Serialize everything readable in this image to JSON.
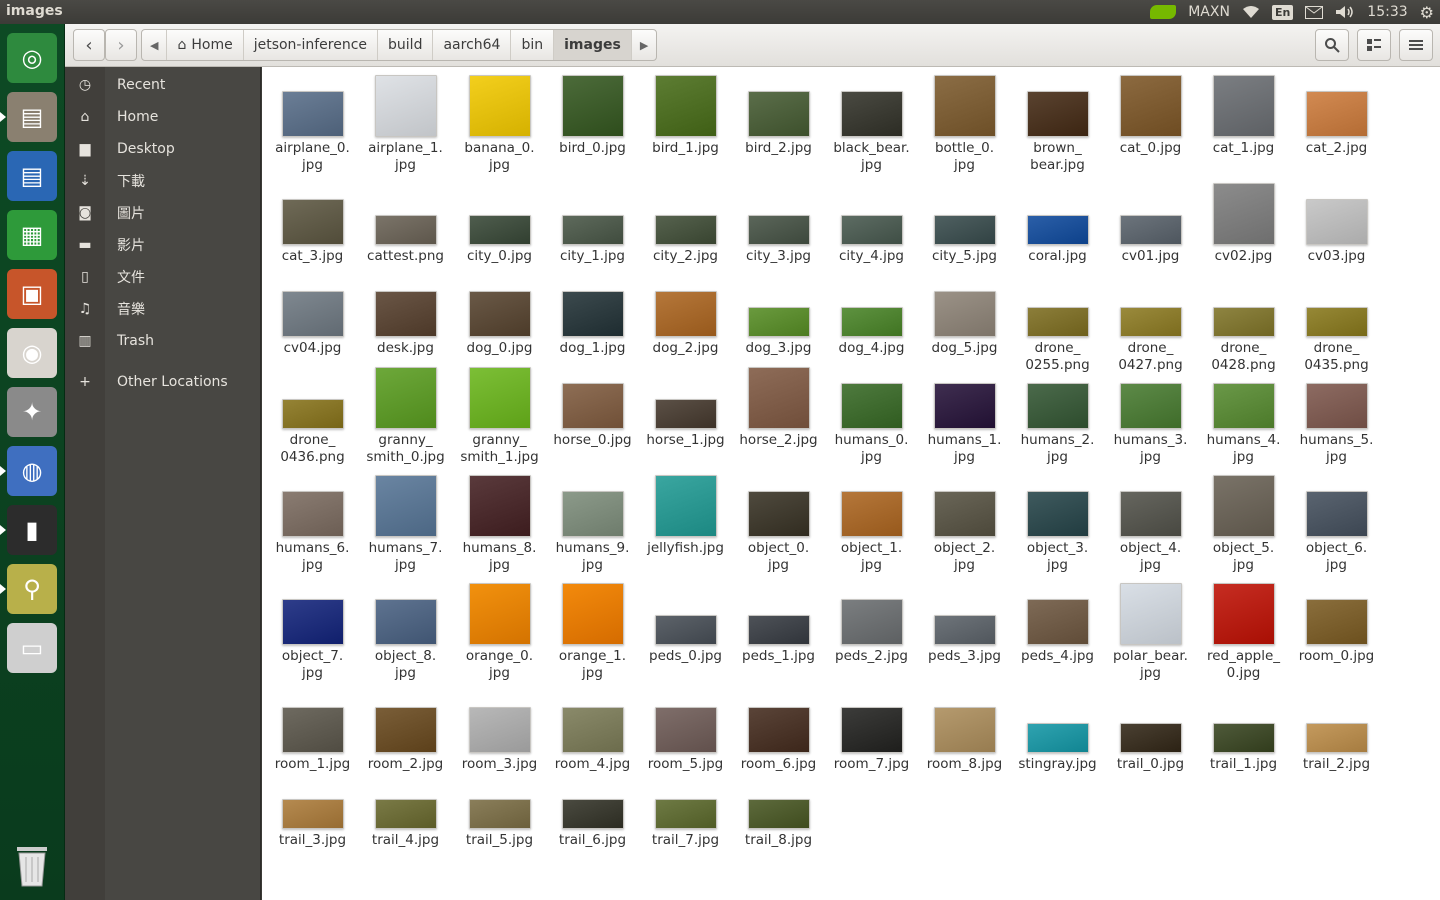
{
  "window": {
    "title": "images"
  },
  "tray": {
    "gpu_mode": "MAXN",
    "lang": "En",
    "time": "15:33"
  },
  "nav": {
    "back": "‹",
    "forward": "›"
  },
  "breadcrumb": [
    {
      "label": "Home",
      "home": true
    },
    {
      "label": "jetson-inference"
    },
    {
      "label": "build"
    },
    {
      "label": "aarch64"
    },
    {
      "label": "bin"
    },
    {
      "label": "images",
      "current": true
    }
  ],
  "sidebar": {
    "items": [
      {
        "icon": "clock-icon",
        "glyph": "◷",
        "label": "Recent"
      },
      {
        "icon": "home-icon",
        "glyph": "⌂",
        "label": "Home"
      },
      {
        "icon": "folder-icon",
        "glyph": "▆",
        "label": "Desktop"
      },
      {
        "icon": "download-icon",
        "glyph": "⇣",
        "label": "下載"
      },
      {
        "icon": "camera-icon",
        "glyph": "◙",
        "label": "圖片"
      },
      {
        "icon": "video-icon",
        "glyph": "▬",
        "label": "影片"
      },
      {
        "icon": "document-icon",
        "glyph": "▯",
        "label": "文件"
      },
      {
        "icon": "music-icon",
        "glyph": "♫",
        "label": "音樂"
      },
      {
        "icon": "trash-icon",
        "glyph": "▥",
        "label": "Trash"
      },
      {
        "icon": "plus-icon",
        "glyph": "+",
        "label": "Other Locations"
      }
    ]
  },
  "rows": [
    [
      {
        "name": "airplane_0.\njpg",
        "c": "#6b7e96"
      },
      {
        "name": "airplane_1.\njpg",
        "c": "#dfe2e6",
        "tall": true
      },
      {
        "name": "banana_0.\njpg",
        "c": "#f3cf1d",
        "tall": true
      },
      {
        "name": "bird_0.jpg",
        "c": "#4c6b3a",
        "tall": true
      },
      {
        "name": "bird_1.jpg",
        "c": "#5d7d33",
        "tall": true
      },
      {
        "name": "bird_2.jpg",
        "c": "#5b6e4a"
      },
      {
        "name": "black_bear.\njpg",
        "c": "#4a4a42"
      },
      {
        "name": "bottle_0.\njpg",
        "c": "#8b6d45",
        "tall": true
      },
      {
        "name": "brown_\nbear.jpg",
        "c": "#5a4330"
      },
      {
        "name": "cat_0.jpg",
        "c": "#8c6a40",
        "tall": true
      },
      {
        "name": "cat_1.jpg",
        "c": "#7b7e82",
        "tall": true
      },
      {
        "name": "cat_2.jpg",
        "c": "#d28a52"
      }
    ],
    [
      {
        "name": "cat_3.jpg",
        "c": "#6f6a57"
      },
      {
        "name": "cattest.png",
        "c": "#7b7469",
        "short": true
      },
      {
        "name": "city_0.jpg",
        "c": "#4f5d4e",
        "short": true
      },
      {
        "name": "city_1.jpg",
        "c": "#5e6a5c",
        "short": true
      },
      {
        "name": "city_2.jpg",
        "c": "#56624e",
        "short": true
      },
      {
        "name": "city_3.jpg",
        "c": "#5b665a",
        "short": true
      },
      {
        "name": "city_4.jpg",
        "c": "#5d6c63",
        "short": true
      },
      {
        "name": "city_5.jpg",
        "c": "#4f6061",
        "short": true
      },
      {
        "name": "coral.jpg",
        "c": "#2b5fa8",
        "short": true
      },
      {
        "name": "cv01.jpg",
        "c": "#6c747c",
        "short": true
      },
      {
        "name": "cv02.jpg",
        "c": "#8c8c8c",
        "tall": true
      },
      {
        "name": "cv03.jpg",
        "c": "#c9c9c9"
      }
    ],
    [
      {
        "name": "cv04.jpg",
        "c": "#7f8890"
      },
      {
        "name": "desk.jpg",
        "c": "#6a5646"
      },
      {
        "name": "dog_0.jpg",
        "c": "#6a5947"
      },
      {
        "name": "dog_1.jpg",
        "c": "#3c4a4e"
      },
      {
        "name": "dog_2.jpg",
        "c": "#b5773a"
      },
      {
        "name": "dog_3.jpg",
        "c": "#6a9a3e",
        "short": true
      },
      {
        "name": "dog_4.jpg",
        "c": "#5e9240",
        "short": true
      },
      {
        "name": "dog_5.jpg",
        "c": "#9b9287"
      },
      {
        "name": "drone_\n0255.png",
        "c": "#8c7e3a",
        "short": true
      },
      {
        "name": "drone_\n0427.png",
        "c": "#9a8a3c",
        "short": true
      },
      {
        "name": "drone_\n0428.png",
        "c": "#8e8441",
        "short": true
      },
      {
        "name": "drone_\n0435.png",
        "c": "#968836",
        "short": true
      }
    ],
    [
      {
        "name": "drone_\n0436.png",
        "c": "#958335",
        "short": true
      },
      {
        "name": "granny_\nsmith_0.jpg",
        "c": "#6da83a",
        "tall": true
      },
      {
        "name": "granny_\nsmith_1.jpg",
        "c": "#7cbf36",
        "tall": true
      },
      {
        "name": "horse_0.jpg",
        "c": "#8e6e55"
      },
      {
        "name": "horse_1.jpg",
        "c": "#5b5046",
        "short": true
      },
      {
        "name": "horse_2.jpg",
        "c": "#8e6c58",
        "tall": true
      },
      {
        "name": "humans_0.\njpg",
        "c": "#4e7a3e"
      },
      {
        "name": "humans_1.\njpg",
        "c": "#3f2e50"
      },
      {
        "name": "humans_2.\njpg",
        "c": "#4b6a4b"
      },
      {
        "name": "humans_3.\njpg",
        "c": "#5d8a48"
      },
      {
        "name": "humans_4.\njpg",
        "c": "#6a9848"
      },
      {
        "name": "humans_5.\njpg",
        "c": "#8d6b62"
      }
    ],
    [
      {
        "name": "humans_6.\njpg",
        "c": "#8a7c72"
      },
      {
        "name": "humans_7.\njpg",
        "c": "#6a85a2",
        "tall": true
      },
      {
        "name": "humans_8.\njpg",
        "c": "#5a3a3c",
        "tall": true
      },
      {
        "name": "humans_9.\njpg",
        "c": "#8c9a8a"
      },
      {
        "name": "jellyfish.jpg",
        "c": "#3aa6a0",
        "tall": true
      },
      {
        "name": "object_0.\njpg",
        "c": "#4f4a3e"
      },
      {
        "name": "object_1.\njpg",
        "c": "#b5773a"
      },
      {
        "name": "object_2.\njpg",
        "c": "#6a6658"
      },
      {
        "name": "object_3.\njpg",
        "c": "#3f5a5e"
      },
      {
        "name": "object_4.\njpg",
        "c": "#66665f"
      },
      {
        "name": "object_5.\njpg",
        "c": "#7a7368",
        "tall": true
      },
      {
        "name": "object_6.\njpg",
        "c": "#5a6470"
      }
    ],
    [
      {
        "name": "object_7.\njpg",
        "c": "#2e3d8a"
      },
      {
        "name": "object_8.\njpg",
        "c": "#5e7390"
      },
      {
        "name": "orange_0.\njpg",
        "c": "#f2910e",
        "tall": true
      },
      {
        "name": "orange_1.\njpg",
        "c": "#f38a0c",
        "tall": true
      },
      {
        "name": "peds_0.jpg",
        "c": "#5d636a",
        "short": true
      },
      {
        "name": "peds_1.jpg",
        "c": "#4e5258",
        "short": true
      },
      {
        "name": "peds_2.jpg",
        "c": "#7b7e80"
      },
      {
        "name": "peds_3.jpg",
        "c": "#6e747a",
        "short": true
      },
      {
        "name": "peds_4.jpg",
        "c": "#7e6a56"
      },
      {
        "name": "polar_bear.\njpg",
        "c": "#d9dfe6",
        "tall": true
      },
      {
        "name": "red_apple_\n0.jpg",
        "c": "#c62d22",
        "tall": true
      },
      {
        "name": "room_0.jpg",
        "c": "#8a6e3c"
      }
    ],
    [
      {
        "name": "room_1.jpg",
        "c": "#6e6a60"
      },
      {
        "name": "room_2.jpg",
        "c": "#7a5e38"
      },
      {
        "name": "room_3.jpg",
        "c": "#b8b8b8"
      },
      {
        "name": "room_4.jpg",
        "c": "#8a8a6a"
      },
      {
        "name": "room_5.jpg",
        "c": "#7f6e6a"
      },
      {
        "name": "room_6.jpg",
        "c": "#5a4438"
      },
      {
        "name": "room_7.jpg",
        "c": "#3c3c3a"
      },
      {
        "name": "room_8.jpg",
        "c": "#b59a6e"
      },
      {
        "name": "stingray.jpg",
        "c": "#2fa3b0",
        "short": true
      },
      {
        "name": "trail_0.jpg",
        "c": "#4a4032",
        "short": true
      },
      {
        "name": "trail_1.jpg",
        "c": "#4f5a3a",
        "short": true
      },
      {
        "name": "trail_2.jpg",
        "c": "#c49a5e",
        "short": true
      }
    ],
    [
      {
        "name": "trail_3.jpg",
        "c": "#b58a50",
        "short": true
      },
      {
        "name": "trail_4.jpg",
        "c": "#7a7a46",
        "short": true
      },
      {
        "name": "trail_5.jpg",
        "c": "#8a7e5a",
        "short": true
      },
      {
        "name": "trail_6.jpg",
        "c": "#4a4a40",
        "short": true
      },
      {
        "name": "trail_7.jpg",
        "c": "#6e7a44",
        "short": true
      },
      {
        "name": "trail_8.jpg",
        "c": "#5d6a3c",
        "short": true
      }
    ]
  ],
  "launcher": [
    {
      "icon": "ubuntu-logo-icon",
      "bg": "#2e8a3e",
      "glyph": "◎"
    },
    {
      "icon": "file-manager-icon",
      "bg": "#8a8070",
      "glyph": "▤"
    },
    {
      "icon": "writer-icon",
      "bg": "#2a67b4",
      "glyph": "▤"
    },
    {
      "icon": "calc-icon",
      "bg": "#2e9a3a",
      "glyph": "▦"
    },
    {
      "icon": "impress-icon",
      "bg": "#c7552a",
      "glyph": "▣"
    },
    {
      "icon": "software-center-icon",
      "bg": "#d8d4ce",
      "glyph": "◉"
    },
    {
      "icon": "settings-icon",
      "bg": "#8a8a8a",
      "glyph": "✦"
    },
    {
      "icon": "chromium-icon",
      "bg": "#3f6fc0",
      "glyph": "◍"
    },
    {
      "icon": "terminal-icon",
      "bg": "#2c2c2c",
      "glyph": "▮"
    },
    {
      "icon": "image-viewer-icon",
      "bg": "#b8b04a",
      "glyph": "⚲"
    },
    {
      "icon": "drive-icon",
      "bg": "#cfcfcf",
      "glyph": "▭"
    }
  ]
}
